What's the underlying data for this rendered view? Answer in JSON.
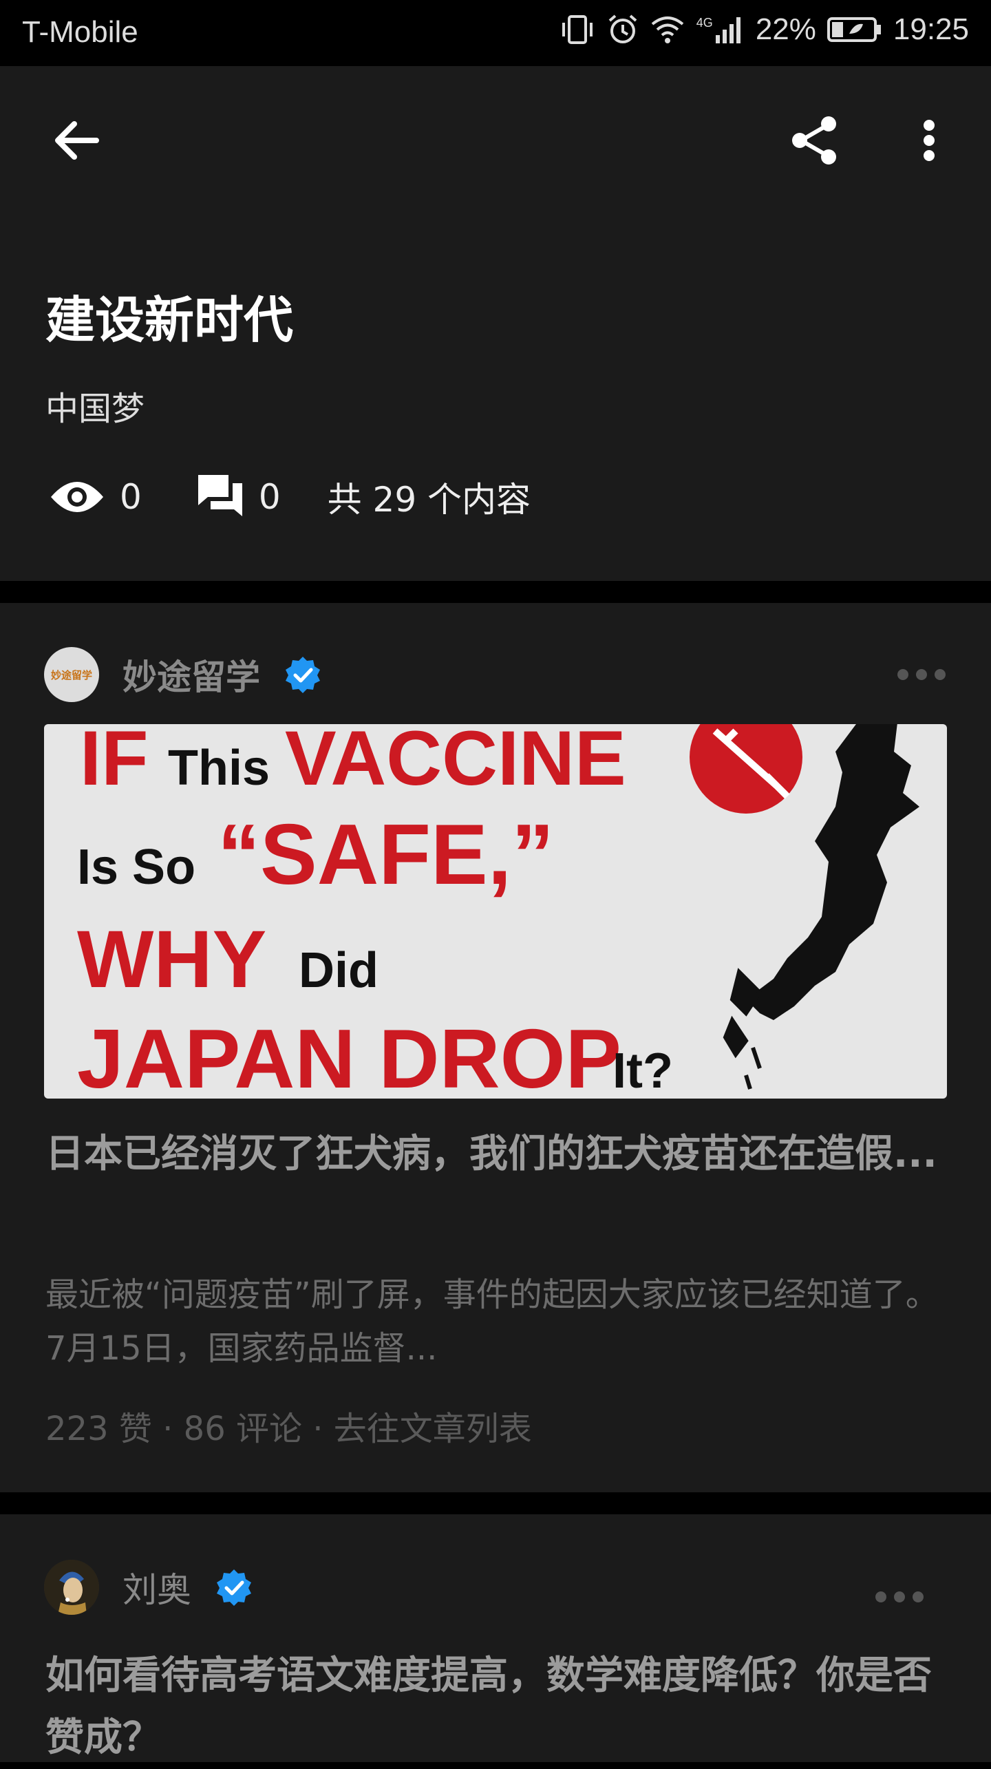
{
  "statusbar": {
    "carrier": "T-Mobile",
    "network": "4G",
    "battery": "22%",
    "time": "19:25"
  },
  "header": {
    "title": "建设新时代",
    "subtitle": "中国梦",
    "views": "0",
    "comments": "0",
    "total": "共 29 个内容"
  },
  "cards": [
    {
      "author": "妙途留学",
      "avatar_text": "妙途留学",
      "image_text": {
        "line1_red": "IF",
        "line1_black": "This",
        "line1_red2": "VACCINE",
        "line2_black": "Is So",
        "line2_red": "“SAFE,”",
        "line3_red": "WHY",
        "line3_black": "Did",
        "line4_red": "JAPAN DROP",
        "line4_black": "It?"
      },
      "title": "日本已经消灭了狂犬病，我们的狂犬疫苗还在造假...",
      "excerpt": "最近被“问题疫苗”刷了屏，事件的起因大家应该已经知道了。7月15日，国家药品监督...",
      "meta": "223 赞 · 86 评论 · 去往文章列表"
    },
    {
      "author": "刘奥",
      "title": "如何看待高考语文难度提高，数学难度降低？你是否赞成？"
    }
  ],
  "colors": {
    "background": "#000000",
    "card": "#1b1b1b",
    "verified": "#2196f3",
    "red": "#cc1a22"
  }
}
